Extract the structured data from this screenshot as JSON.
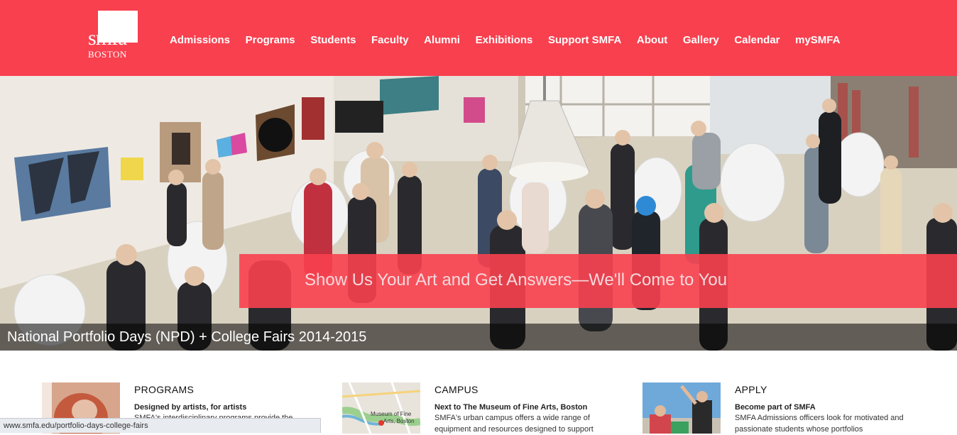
{
  "colors": {
    "brand": "#f8404f",
    "banner_text": "#f6d9dc"
  },
  "logo": {
    "smfa": "smfa",
    "city": "BOSTON"
  },
  "nav": [
    {
      "label": "Admissions"
    },
    {
      "label": "Programs"
    },
    {
      "label": "Students"
    },
    {
      "label": "Faculty"
    },
    {
      "label": "Alumni"
    },
    {
      "label": "Exhibitions"
    },
    {
      "label": "Support SMFA"
    },
    {
      "label": "About"
    },
    {
      "label": "Gallery"
    },
    {
      "label": "Calendar"
    },
    {
      "label": "mySMFA"
    }
  ],
  "hero": {
    "banner": "Show Us Your Art and Get Answers—We'll Come to You",
    "caption": "National Portfolio Days (NPD) + College Fairs 2014-2015"
  },
  "features": [
    {
      "title": "PROGRAMS",
      "subtitle": "Designed by artists, for artists",
      "body": "SMFA's interdisciplinary programs provide the"
    },
    {
      "title": "CAMPUS",
      "subtitle": "Next to The Museum of Fine Arts, Boston",
      "body": "SMFA's urban campus offers a wide range of equipment and resources designed to support",
      "map_label": "Museum of Fine Arts, Boston"
    },
    {
      "title": "APPLY",
      "subtitle": "Become part of SMFA",
      "body": "SMFA Admissions officers look for motivated and passionate students whose portfolios"
    }
  ],
  "status_url": "www.smfa.edu/portfolio-days-college-fairs"
}
